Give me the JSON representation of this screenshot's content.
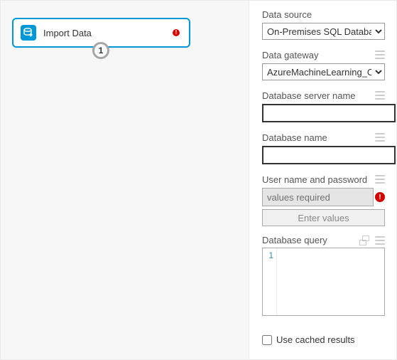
{
  "canvas": {
    "node": {
      "title": "Import Data",
      "icon": "database-import-icon",
      "has_error": true,
      "port_number": "1"
    }
  },
  "panel": {
    "data_source": {
      "label": "Data source",
      "value": "On-Premises SQL Database"
    },
    "data_gateway": {
      "label": "Data gateway",
      "value": "AzureMachineLearning_On"
    },
    "db_server": {
      "label": "Database server name",
      "value": ""
    },
    "db_name": {
      "label": "Database name",
      "value": ""
    },
    "credentials": {
      "label": "User name and password",
      "placeholder": "values required",
      "button": "Enter values"
    },
    "query": {
      "label": "Database query",
      "line_no": "1",
      "value": ""
    },
    "cache": {
      "label": "Use cached results",
      "checked": false
    }
  }
}
